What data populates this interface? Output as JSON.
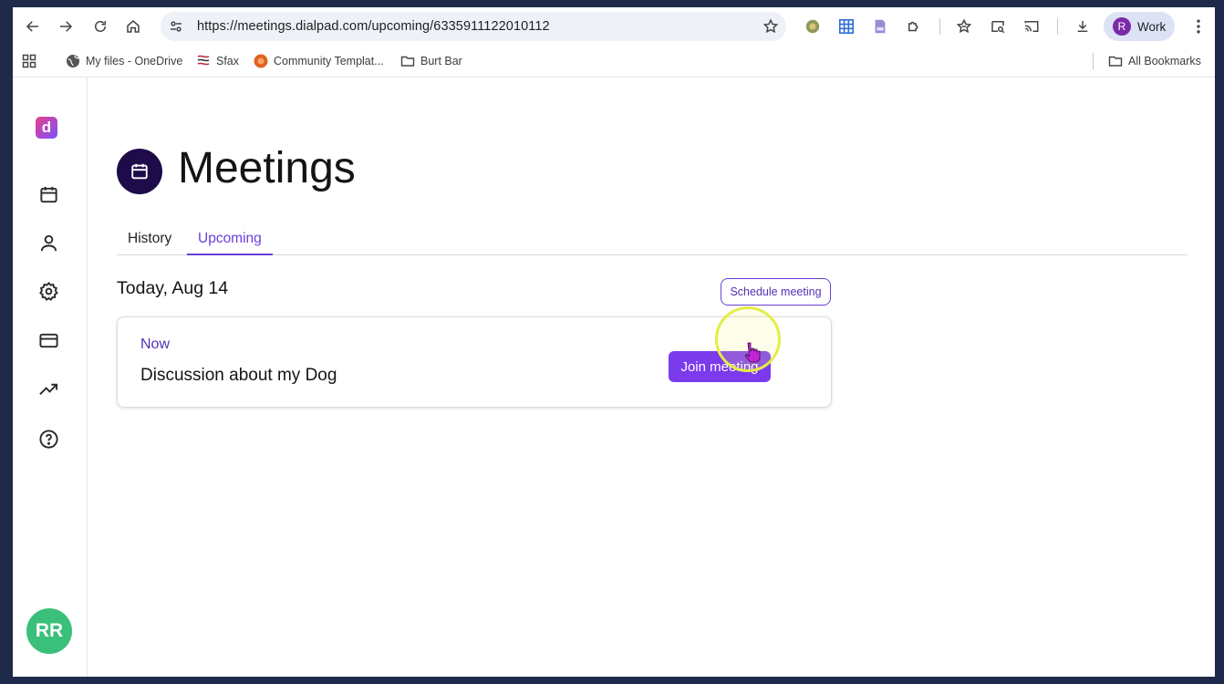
{
  "browser": {
    "url": "https://meetings.dialpad.com/upcoming/6335911122010112",
    "profile": {
      "initial": "R",
      "label": "Work"
    },
    "bookmarks": [
      {
        "label": "My files - OneDrive",
        "icon": "globe-icon"
      },
      {
        "label": "Sfax",
        "icon": "sfax-icon"
      },
      {
        "label": "Community Templat...",
        "icon": "community-icon"
      },
      {
        "label": "Burt Bar",
        "icon": "folder-icon"
      }
    ],
    "all_bookmarks_label": "All Bookmarks"
  },
  "sidebar": {
    "logo_letter": "d",
    "items": [
      "calendar-icon",
      "person-icon",
      "gear-icon",
      "card-icon",
      "trending-icon",
      "help-icon"
    ],
    "user_initials": "RR"
  },
  "main": {
    "title": "Meetings",
    "tabs": [
      {
        "label": "History",
        "active": false
      },
      {
        "label": "Upcoming",
        "active": true
      }
    ],
    "date_heading": "Today, Aug 14",
    "schedule_button": "Schedule meeting",
    "meeting": {
      "when": "Now",
      "title": "Discussion about my Dog",
      "join_label": "Join meeting"
    }
  },
  "colors": {
    "accent": "#7c3aed",
    "title_icon_bg": "#1e0b4a",
    "avatar_bg": "#3ac07a"
  }
}
